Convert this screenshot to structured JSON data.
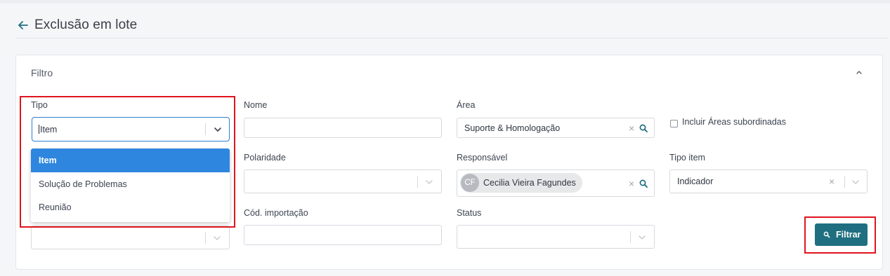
{
  "header": {
    "title": "Exclusão em lote"
  },
  "filter": {
    "title": "Filtro",
    "tipo": {
      "label": "Tipo",
      "value": "Item"
    },
    "tipo_options": [
      "Item",
      "Solução de Problemas",
      "Reunião"
    ],
    "nome": {
      "label": "Nome",
      "value": ""
    },
    "area": {
      "label": "Área",
      "value": "Suporte & Homologação"
    },
    "incluir_areas": {
      "label": "Incluir Áreas subordinadas",
      "checked": false
    },
    "polaridade": {
      "label": "Polaridade",
      "value": ""
    },
    "responsavel": {
      "label": "Responsável",
      "initials": "CF",
      "name": "Cecilia Vieira Fagundes"
    },
    "tipo_item": {
      "label": "Tipo item",
      "value": "Indicador"
    },
    "cod_importacao": {
      "label": "Cód. importação",
      "value": ""
    },
    "status": {
      "label": "Status",
      "value": ""
    },
    "filtrar_button": "Filtrar"
  },
  "colors": {
    "accent": "#1f6f80",
    "focus_border": "#2b7fd4",
    "selected_option": "#2e86de",
    "highlight": "#e0141e"
  },
  "icons": {
    "back": "arrow-left-icon",
    "collapse": "chevron-up-icon",
    "select_chevron": "chevron-down-icon",
    "clear": "close-icon",
    "search": "search-icon"
  }
}
